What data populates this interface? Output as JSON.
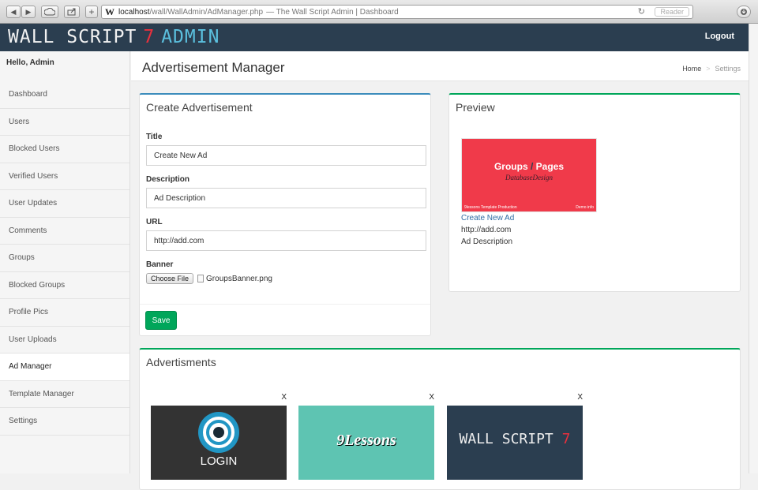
{
  "browser": {
    "back": "◀",
    "forward": "▶",
    "add": "+",
    "site_icon": "W",
    "url_host": "localhost",
    "url_path": "/wall/WallAdmin/AdManager.php",
    "page_title": "— The Wall Script Admin | Dashboard",
    "reader": "Reader",
    "reload_icon": "reload-icon",
    "cloud_icon": "cloud-icon",
    "share_icon": "share-icon",
    "download_icon": "download-icon"
  },
  "header": {
    "logo_part1": "WALL SCRIPT",
    "logo_part2": "7",
    "logo_part3": "ADMIN",
    "logout": "Logout"
  },
  "sidebar": {
    "greeting": "Hello, Admin",
    "items": [
      {
        "label": "Dashboard"
      },
      {
        "label": "Users"
      },
      {
        "label": "Blocked Users"
      },
      {
        "label": "Verified Users"
      },
      {
        "label": "User Updates"
      },
      {
        "label": "Comments"
      },
      {
        "label": "Groups"
      },
      {
        "label": "Blocked Groups"
      },
      {
        "label": "Profile Pics"
      },
      {
        "label": "User Uploads"
      },
      {
        "label": "Ad Manager"
      },
      {
        "label": "Template Manager"
      },
      {
        "label": "Settings"
      }
    ],
    "active_index": 10
  },
  "page": {
    "title": "Advertisement Manager",
    "breadcrumb": [
      "Home",
      ">",
      "Settings"
    ]
  },
  "create_form": {
    "panel_title": "Create Advertisement",
    "title_label": "Title",
    "title_value": "Create New Ad",
    "description_label": "Description",
    "description_value": "Ad Description",
    "url_label": "URL",
    "url_value": "http://add.com",
    "banner_label": "Banner",
    "choose_file": "Choose File",
    "file_name": "GroupsBanner.png",
    "save": "Save"
  },
  "preview": {
    "panel_title": "Preview",
    "banner_groups": "Groups",
    "banner_slash": "/",
    "banner_pages": "Pages",
    "banner_sub": "DatabaseDesign",
    "banner_footer_left": "9lessons Template Production",
    "banner_footer_right": "Demo info",
    "ad_title": "Create New Ad",
    "ad_url": "http://add.com",
    "ad_description": "Ad Description"
  },
  "advertisements": {
    "panel_title": "Advertisments",
    "items": [
      {
        "close": "X",
        "image_text": "LOGIN"
      },
      {
        "close": "X",
        "image_text": "9Lessons"
      },
      {
        "close": "X",
        "image_text": "WALL SCRIPT",
        "image_accent": "7"
      }
    ]
  },
  "colors": {
    "header_bg": "#2b3e50",
    "accent_blue": "#3c8dbc",
    "accent_green": "#00a65a",
    "logo_red": "#e8303d",
    "logo_cyan": "#5bc0de"
  }
}
